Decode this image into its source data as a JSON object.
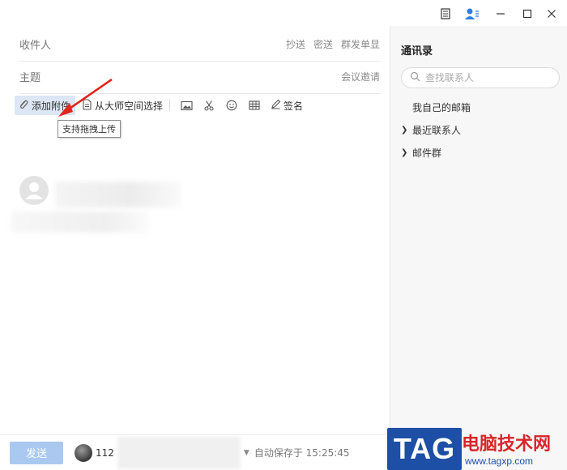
{
  "compose": {
    "to_label": "收件人",
    "cc_label": "抄送",
    "bcc_label": "密送",
    "group_label": "群发单显",
    "subject_label": "主题",
    "meeting_label": "会议邀请"
  },
  "toolbar": {
    "attach_label": "添加附件",
    "master_space_label": "从大师空间选择",
    "signature_label": "签名",
    "tooltip": "支持拖拽上传",
    "icons": [
      "paperclip-icon",
      "document-icon",
      "image-icon",
      "scissors-icon",
      "emoji-icon",
      "table-icon",
      "pen-icon"
    ]
  },
  "bottom": {
    "send_label": "发送",
    "account_prefix": "112",
    "autosave": "自动保存于 15:25:45"
  },
  "contacts": {
    "title": "通讯录",
    "search_placeholder": "查找联系人",
    "items": [
      {
        "label": "我自己的邮箱",
        "expandable": false
      },
      {
        "label": "最近联系人",
        "expandable": true
      },
      {
        "label": "邮件群",
        "expandable": true
      }
    ]
  },
  "watermark": {
    "logo": "TAG",
    "text": "电脑技术网",
    "url": "www.tagxp.com"
  },
  "colors": {
    "attach_bg": "#dce6f4",
    "send_bg": "#a9c9f0",
    "arrow": "#e0261d",
    "brand_blue": "#1e4fa6"
  }
}
